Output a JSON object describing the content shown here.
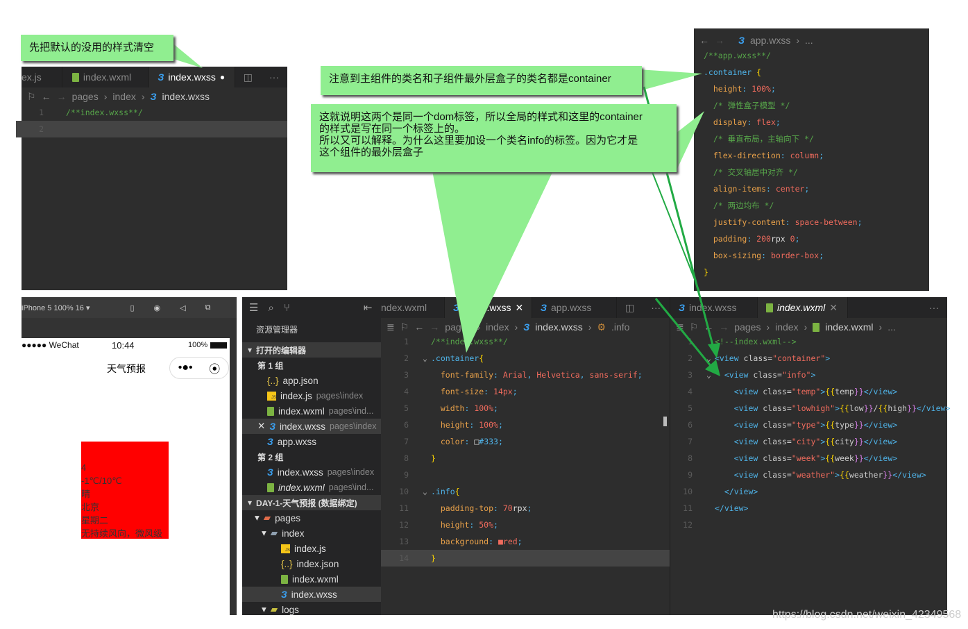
{
  "annotations": {
    "clear_default": "先把默认的没用的样式清空",
    "same_class": "注意到主组件的类名和子组件最外层盒子的类名都是container",
    "explain": [
      "这就说明这两个是同一个dom标签，所以全局的样式和这里的container",
      "的样式是写在同一个标签上的。",
      "所以又可以解释。为什么这里要加设一个类名info的标签。因为它才是",
      "这个组件的最外层盒子"
    ]
  },
  "colors": {
    "callout": "#90ee90",
    "arrow": "#22aa44",
    "editor_bg": "#2d2d2d",
    "info_bg": "#ff0000"
  },
  "editor_top_left": {
    "tabs": [
      {
        "label": "ex.js"
      },
      {
        "label": "index.wxml",
        "icon": "wxml-file-icon"
      },
      {
        "label": "index.wxss",
        "icon": "wxss-file-icon",
        "modified": "●"
      }
    ],
    "breadcrumb": [
      "pages",
      "index",
      "index.wxss"
    ],
    "lines": [
      [
        [
          "/**index.wxss**/",
          "c"
        ]
      ],
      []
    ]
  },
  "editor_app_wxss": {
    "breadcrumb": [
      "app.wxss",
      "..."
    ],
    "lines": [
      [
        [
          "/**app.wxss**/",
          "c"
        ]
      ],
      [
        [
          ".container ",
          "s"
        ],
        [
          "{",
          "b"
        ]
      ],
      [
        [
          "  height",
          "p"
        ],
        [
          ": ",
          "u"
        ],
        [
          "100%",
          "v"
        ],
        [
          ";",
          "u"
        ]
      ],
      [
        [
          "  /* 弹性盒子模型 */",
          "c"
        ]
      ],
      [
        [
          "  display",
          "p"
        ],
        [
          ": ",
          "u"
        ],
        [
          "flex",
          "v"
        ],
        [
          ";",
          "u"
        ]
      ],
      [
        [
          "  /* 垂直布局，主轴向下 */",
          "c"
        ]
      ],
      [
        [
          "  flex-direction",
          "p"
        ],
        [
          ": ",
          "u"
        ],
        [
          "column",
          "v"
        ],
        [
          ";",
          "u"
        ]
      ],
      [
        [
          "  /* 交叉轴居中对齐 */",
          "c"
        ]
      ],
      [
        [
          "  align-items",
          "p"
        ],
        [
          ": ",
          "u"
        ],
        [
          "center",
          "v"
        ],
        [
          ";",
          "u"
        ]
      ],
      [
        [
          "  /* 两边均布 */",
          "c"
        ]
      ],
      [
        [
          "  justify-content",
          "p"
        ],
        [
          ": ",
          "u"
        ],
        [
          "space-between",
          "v"
        ],
        [
          ";",
          "u"
        ]
      ],
      [
        [
          "  padding",
          "p"
        ],
        [
          ": ",
          "u"
        ],
        [
          "200",
          "v"
        ],
        [
          "rpx ",
          "w"
        ],
        [
          "0",
          "v"
        ],
        [
          ";",
          "u"
        ]
      ],
      [
        [
          "  box-sizing",
          "p"
        ],
        [
          ": ",
          "u"
        ],
        [
          "border-box",
          "v"
        ],
        [
          ";",
          "u"
        ]
      ],
      [
        [
          "}",
          "b"
        ]
      ]
    ]
  },
  "simulator": {
    "device": "iPhone 5 100% 16 ▾",
    "status": {
      "carrier": "●●●●● WeChat",
      "time": "10:44",
      "battery": "100%"
    },
    "nav_title": "天气预报",
    "info_lines": [
      "4",
      "-1℃/10℃",
      "晴",
      "北京",
      "星期二",
      "无持续风向，微风级"
    ]
  },
  "explorer": {
    "title": "资源管理器",
    "open_editors": "打开的编辑器",
    "groups": [
      {
        "label": "第 1 组",
        "items": [
          {
            "name": "app.json",
            "path": "",
            "icon": "json"
          },
          {
            "name": "index.js",
            "path": "pages\\index",
            "icon": "js"
          },
          {
            "name": "index.wxml",
            "path": "pages\\ind...",
            "icon": "xml"
          },
          {
            "name": "index.wxss",
            "path": "pages\\index",
            "icon": "css",
            "selected": true
          },
          {
            "name": "app.wxss",
            "path": "",
            "icon": "css"
          }
        ]
      },
      {
        "label": "第 2 组",
        "items": [
          {
            "name": "index.wxss",
            "path": "pages\\index",
            "icon": "css"
          },
          {
            "name": "index.wxml",
            "path": "pages\\ind...",
            "icon": "xml"
          }
        ]
      }
    ],
    "project": "DAY-1-天气预报 (数据绑定)",
    "tree": [
      {
        "name": "pages",
        "depth": 1,
        "icon": "folder"
      },
      {
        "name": "index",
        "depth": 2,
        "icon": "folder"
      },
      {
        "name": "index.js",
        "depth": 3,
        "icon": "js"
      },
      {
        "name": "index.json",
        "depth": 3,
        "icon": "json"
      },
      {
        "name": "index.wxml",
        "depth": 3,
        "icon": "xml"
      },
      {
        "name": "index.wxss",
        "depth": 3,
        "icon": "css",
        "selected": true
      },
      {
        "name": "logs",
        "depth": 2,
        "icon": "folder"
      }
    ]
  },
  "editor_index_wxss": {
    "tabs": [
      {
        "label": "ndex.wxml"
      },
      {
        "label": "index.wxss",
        "close": "✕"
      },
      {
        "label": "app.wxss"
      }
    ],
    "breadcrumb": [
      "pages",
      "index",
      "index.wxss",
      ".info"
    ],
    "lines": [
      [
        [
          "/**index.wxss**/",
          "c"
        ]
      ],
      [
        [
          ".container",
          "s"
        ],
        [
          "{",
          "b"
        ]
      ],
      [
        [
          "  font-family",
          "p"
        ],
        [
          ": ",
          "u"
        ],
        [
          "Arial",
          "v"
        ],
        [
          ", ",
          "u"
        ],
        [
          "Helvetica",
          "v"
        ],
        [
          ", ",
          "u"
        ],
        [
          "sans-serif",
          "v"
        ],
        [
          ";",
          "u"
        ]
      ],
      [
        [
          "  font-size",
          "p"
        ],
        [
          ": ",
          "u"
        ],
        [
          "14px",
          "v"
        ],
        [
          ";",
          "u"
        ]
      ],
      [
        [
          "  width",
          "p"
        ],
        [
          ": ",
          "u"
        ],
        [
          "100%",
          "v"
        ],
        [
          ";",
          "u"
        ]
      ],
      [
        [
          "  height",
          "p"
        ],
        [
          ": ",
          "u"
        ],
        [
          "100%",
          "v"
        ],
        [
          ";",
          "u"
        ]
      ],
      [
        [
          "  color",
          "p"
        ],
        [
          ": ",
          "u"
        ],
        [
          "□",
          "w"
        ],
        [
          "#333",
          "s"
        ],
        [
          ";",
          "u"
        ]
      ],
      [
        [
          "}",
          "b"
        ]
      ],
      [],
      [
        [
          ".info",
          "s"
        ],
        [
          "{",
          "b"
        ]
      ],
      [
        [
          "  padding-top",
          "p"
        ],
        [
          ": ",
          "u"
        ],
        [
          "70",
          "v"
        ],
        [
          "rpx",
          "w"
        ],
        [
          ";",
          "u"
        ]
      ],
      [
        [
          "  height",
          "p"
        ],
        [
          ": ",
          "u"
        ],
        [
          "50%",
          "v"
        ],
        [
          ";",
          "u"
        ]
      ],
      [
        [
          "  background",
          "p"
        ],
        [
          ": ",
          "u"
        ],
        [
          "■",
          "v"
        ],
        [
          "red",
          "v"
        ],
        [
          ";",
          "u"
        ]
      ],
      [
        [
          "}",
          "b"
        ]
      ]
    ]
  },
  "editor_index_wxml": {
    "tabs": [
      {
        "label": "index.wxss"
      },
      {
        "label": "index.wxml",
        "close": "✕"
      }
    ],
    "breadcrumb": [
      "pages",
      "index",
      "index.wxml",
      "..."
    ],
    "lines": [
      [
        [
          "<!--index.wxml-->",
          "c"
        ]
      ],
      [
        [
          "<view ",
          "t"
        ],
        [
          "class=",
          "a"
        ],
        [
          "\"container\"",
          "q"
        ],
        [
          ">",
          "t"
        ]
      ],
      [
        [
          "  <view ",
          "t"
        ],
        [
          "class=",
          "a"
        ],
        [
          "\"info\"",
          "q"
        ],
        [
          ">",
          "t"
        ]
      ],
      [
        [
          "    <view ",
          "t"
        ],
        [
          "class=",
          "a"
        ],
        [
          "\"temp\"",
          "q"
        ],
        [
          ">",
          "t"
        ],
        [
          "{{",
          "b"
        ],
        [
          "temp",
          "a"
        ],
        [
          "}}",
          "m"
        ],
        [
          "</view>",
          "t"
        ]
      ],
      [
        [
          "    <view ",
          "t"
        ],
        [
          "class=",
          "a"
        ],
        [
          "\"lowhigh\"",
          "q"
        ],
        [
          ">",
          "t"
        ],
        [
          "{{",
          "b"
        ],
        [
          "low",
          "a"
        ],
        [
          "}}",
          "m"
        ],
        [
          "/",
          "a"
        ],
        [
          "{{",
          "b"
        ],
        [
          "high",
          "a"
        ],
        [
          "}}",
          "m"
        ],
        [
          "</view>",
          "t"
        ]
      ],
      [
        [
          "    <view ",
          "t"
        ],
        [
          "class=",
          "a"
        ],
        [
          "\"type\"",
          "q"
        ],
        [
          ">",
          "t"
        ],
        [
          "{{",
          "b"
        ],
        [
          "type",
          "a"
        ],
        [
          "}}",
          "m"
        ],
        [
          "</view>",
          "t"
        ]
      ],
      [
        [
          "    <view ",
          "t"
        ],
        [
          "class=",
          "a"
        ],
        [
          "\"city\"",
          "q"
        ],
        [
          ">",
          "t"
        ],
        [
          "{{",
          "b"
        ],
        [
          "city",
          "a"
        ],
        [
          "}}",
          "m"
        ],
        [
          "</view>",
          "t"
        ]
      ],
      [
        [
          "    <view ",
          "t"
        ],
        [
          "class=",
          "a"
        ],
        [
          "\"week\"",
          "q"
        ],
        [
          ">",
          "t"
        ],
        [
          "{{",
          "b"
        ],
        [
          "week",
          "a"
        ],
        [
          "}}",
          "m"
        ],
        [
          "</view>",
          "t"
        ]
      ],
      [
        [
          "    <view ",
          "t"
        ],
        [
          "class=",
          "a"
        ],
        [
          "\"weather\"",
          "q"
        ],
        [
          ">",
          "t"
        ],
        [
          "{{",
          "b"
        ],
        [
          "weather",
          "a"
        ],
        [
          "}}",
          "m"
        ],
        [
          "</view>",
          "t"
        ]
      ],
      [
        [
          "  </view>",
          "t"
        ]
      ],
      [
        [
          "</view>",
          "t"
        ]
      ],
      []
    ]
  },
  "watermark": "https://blog.csdn.net/weixin_42349568"
}
